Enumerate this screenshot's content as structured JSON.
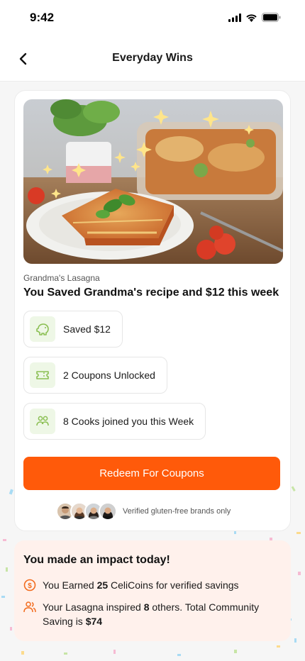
{
  "status_bar": {
    "time": "9:42"
  },
  "nav": {
    "title": "Everyday Wins",
    "back_icon": "chevron-left-icon"
  },
  "card": {
    "recipe_caption": "Grandma's Lasagna",
    "headline": "You Saved Grandma's recipe and $12 this week",
    "stats": [
      {
        "icon": "piggy-bank-icon",
        "label": "Saved  $12"
      },
      {
        "icon": "ticket-icon",
        "label": "2 Coupons Unlocked"
      },
      {
        "icon": "people-icon",
        "label": "8 Cooks joined you this Week"
      }
    ],
    "cta_label": "Redeem For Coupons",
    "brands_note": "Verified gluten-free brands only"
  },
  "impact": {
    "title": "You made an impact today!",
    "rows": [
      {
        "icon": "coin-icon",
        "prefix": "You Earned ",
        "highlight": "25",
        "suffix": " CeliCoins for verified savings"
      },
      {
        "icon": "community-icon",
        "prefix": "Your Lasagna inspired ",
        "highlight": "8",
        "middle": " others. Total Community Saving is ",
        "highlight2": "$74"
      }
    ]
  },
  "colors": {
    "accent": "#ff5a0a",
    "icon_bg": "#eef7e6",
    "icon_green": "#7cb342",
    "impact_bg": "#fff1ec"
  }
}
